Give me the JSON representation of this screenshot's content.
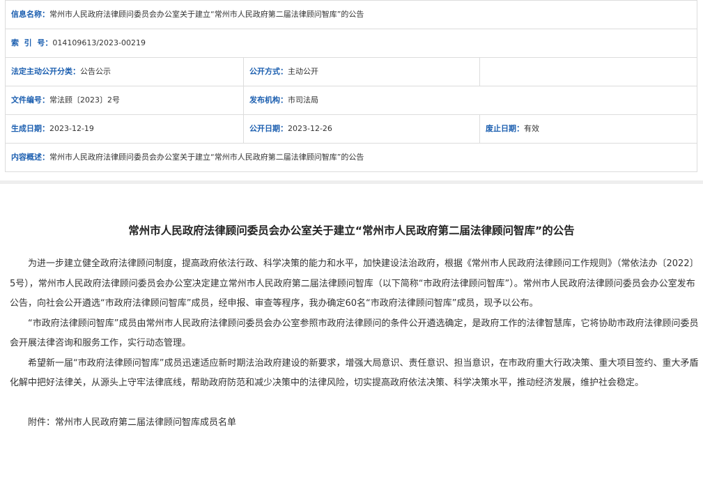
{
  "meta": {
    "info_name": {
      "label": "信息名称：",
      "value": "常州市人民政府法律顾问委员会办公室关于建立“常州市人民政府第二届法律顾问智库”的公告"
    },
    "index_no": {
      "label": "索  引  号：",
      "value": "014109613/2023-00219"
    },
    "category": {
      "label": "法定主动公开分类：",
      "value": "公告公示"
    },
    "disclosure_mode": {
      "label": "公开方式：",
      "value": "主动公开"
    },
    "doc_number": {
      "label": "文件编号：",
      "value": "常法顾〔2023〕2号"
    },
    "issuer": {
      "label": "发布机构：",
      "value": "市司法局"
    },
    "created_date": {
      "label": "生成日期：",
      "value": "2023-12-19"
    },
    "public_date": {
      "label": "公开日期：",
      "value": "2023-12-26"
    },
    "expiry": {
      "label": "废止日期：",
      "value": "有效"
    },
    "summary": {
      "label": "内容概述：",
      "value": "常州市人民政府法律顾问委员会办公室关于建立“常州市人民政府第二届法律顾问智库”的公告"
    }
  },
  "article": {
    "title": "常州市人民政府法律顾问委员会办公室关于建立“常州市人民政府第二届法律顾问智库”的公告",
    "paragraphs": [
      "为进一步建立健全政府法律顾问制度，提高政府依法行政、科学决策的能力和水平，加快建设法治政府，根据《常州市人民政府法律顾问工作规则》（常依法办〔2022〕5号），常州市人民政府法律顾问委员会办公室决定建立常州市人民政府第二届法律顾问智库（以下简称“市政府法律顾问智库”）。常州市人民政府法律顾问委员会办公室发布公告，向社会公开遴选“市政府法律顾问智库”成员，经申报、审查等程序，我办确定60名“市政府法律顾问智库”成员，现予以公布。",
      "“市政府法律顾问智库”成员由常州市人民政府法律顾问委员会办公室参照市政府法律顾问的条件公开遴选确定，是政府工作的法律智慧库，它将协助市政府法律顾问委员会开展法律咨询和服务工作，实行动态管理。",
      "希望新一届“市政府法律顾问智库”成员迅速适应新时期法治政府建设的新要求，增强大局意识、责任意识、担当意识，在市政府重大行政决策、重大项目签约、重大矛盾化解中把好法律关，从源头上守牢法律底线，帮助政府防范和减少决策中的法律风险，切实提高政府依法决策、科学决策水平，推动经济发展，维护社会稳定。"
    ],
    "attachment": "附件：常州市人民政府第二届法律顾问智库成员名单"
  }
}
